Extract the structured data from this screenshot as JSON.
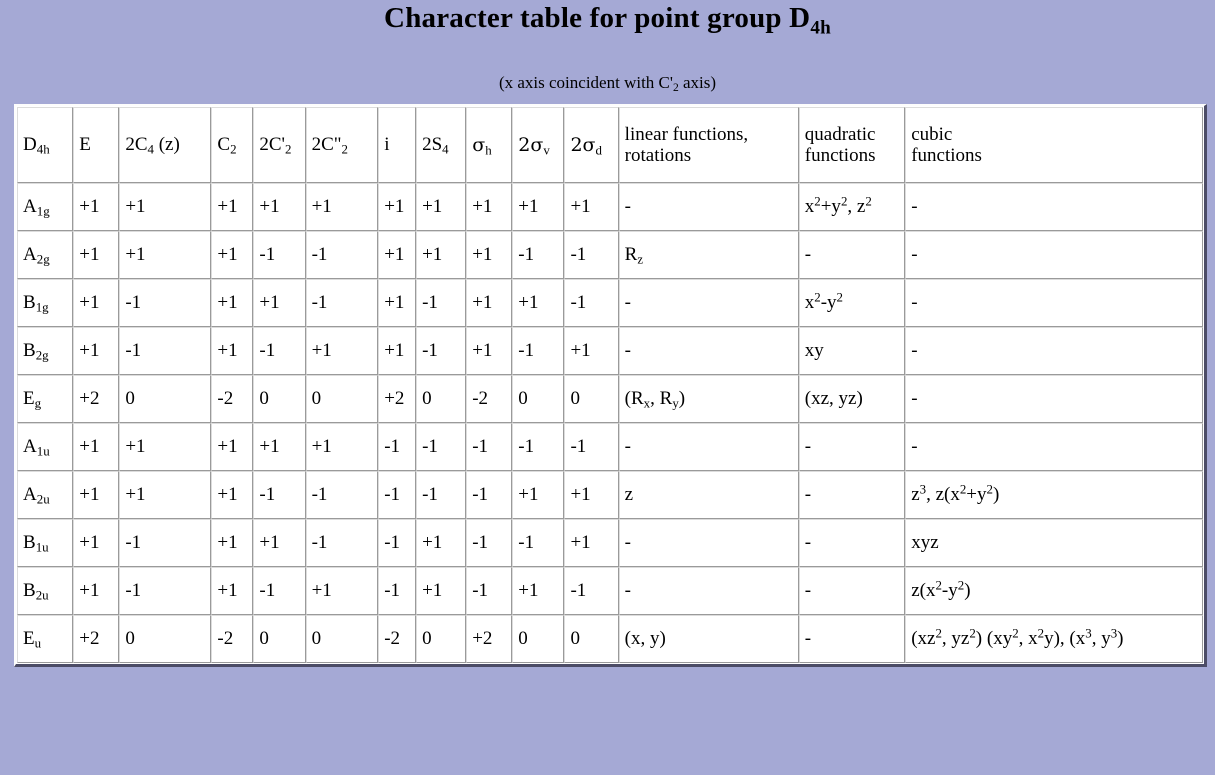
{
  "title": {
    "text_main": "Character table for point group D",
    "text_sub": "4h",
    "subtitle_before": "(x axis coincident with C'",
    "subtitle_sub": "2",
    "subtitle_after": " axis)"
  },
  "colors": {
    "page_background": "#a5a9d5",
    "table_background": "#ffffff",
    "border_dark": "#4c4c66",
    "cell_border_light": "#dcdcdc",
    "cell_border_dark": "#9a9a9a",
    "text": "#000000"
  },
  "table": {
    "headers": [
      {
        "base": "D",
        "sub": "4h",
        "bold": true
      },
      {
        "base": "E"
      },
      {
        "base": "2C",
        "sub": "4",
        "after": " (z)"
      },
      {
        "base": "C",
        "sub": "2"
      },
      {
        "base": "2C'",
        "sub": "2"
      },
      {
        "base": "2C\"",
        "sub": "2"
      },
      {
        "base": "i"
      },
      {
        "base": "2S",
        "sub": "4"
      },
      {
        "base": "σ",
        "sub": "h"
      },
      {
        "base": "2σ",
        "sub": "v"
      },
      {
        "base": "2σ",
        "sub": "d"
      },
      {
        "line1": "linear functions,",
        "line2": "rotations"
      },
      {
        "line1": "quadratic",
        "line2": "functions"
      },
      {
        "line1": "cubic",
        "line2": "functions"
      }
    ],
    "rows": [
      {
        "symbol_base": "A",
        "symbol_sub": "1g",
        "characters": [
          "+1",
          "+1",
          "+1",
          "+1",
          "+1",
          "+1",
          "+1",
          "+1",
          "+1",
          "+1"
        ],
        "linear": "-",
        "quadratic": "x<sup>2</sup>+y<sup>2</sup>, z<sup>2</sup>",
        "cubic": "-"
      },
      {
        "symbol_base": "A",
        "symbol_sub": "2g",
        "characters": [
          "+1",
          "+1",
          "+1",
          "-1",
          "-1",
          "+1",
          "+1",
          "+1",
          "-1",
          "-1"
        ],
        "linear": "R<sub>z</sub>",
        "quadratic": "-",
        "cubic": "-"
      },
      {
        "symbol_base": "B",
        "symbol_sub": "1g",
        "characters": [
          "+1",
          "-1",
          "+1",
          "+1",
          "-1",
          "+1",
          "-1",
          "+1",
          "+1",
          "-1"
        ],
        "linear": "-",
        "quadratic": "x<sup>2</sup>-y<sup>2</sup>",
        "cubic": "-"
      },
      {
        "symbol_base": "B",
        "symbol_sub": "2g",
        "characters": [
          "+1",
          "-1",
          "+1",
          "-1",
          "+1",
          "+1",
          "-1",
          "+1",
          "-1",
          "+1"
        ],
        "linear": "-",
        "quadratic": "xy",
        "cubic": "-"
      },
      {
        "symbol_base": "E",
        "symbol_sub": "g",
        "characters": [
          "+2",
          "0",
          "-2",
          "0",
          "0",
          "+2",
          "0",
          "-2",
          "0",
          "0"
        ],
        "linear": "(R<sub>x</sub>, R<sub>y</sub>)",
        "quadratic": "(xz, yz)",
        "cubic": "-"
      },
      {
        "symbol_base": "A",
        "symbol_sub": "1u",
        "characters": [
          "+1",
          "+1",
          "+1",
          "+1",
          "+1",
          "-1",
          "-1",
          "-1",
          "-1",
          "-1"
        ],
        "linear": "-",
        "quadratic": "-",
        "cubic": "-"
      },
      {
        "symbol_base": "A",
        "symbol_sub": "2u",
        "characters": [
          "+1",
          "+1",
          "+1",
          "-1",
          "-1",
          "-1",
          "-1",
          "-1",
          "+1",
          "+1"
        ],
        "linear": "z",
        "quadratic": "-",
        "cubic": "z<sup>3</sup>, z(x<sup>2</sup>+y<sup>2</sup>)"
      },
      {
        "symbol_base": "B",
        "symbol_sub": "1u",
        "characters": [
          "+1",
          "-1",
          "+1",
          "+1",
          "-1",
          "-1",
          "+1",
          "-1",
          "-1",
          "+1"
        ],
        "linear": "-",
        "quadratic": "-",
        "cubic": "xyz"
      },
      {
        "symbol_base": "B",
        "symbol_sub": "2u",
        "characters": [
          "+1",
          "-1",
          "+1",
          "-1",
          "+1",
          "-1",
          "+1",
          "-1",
          "+1",
          "-1"
        ],
        "linear": "-",
        "quadratic": "-",
        "cubic": "z(x<sup>2</sup>-y<sup>2</sup>)"
      },
      {
        "symbol_base": "E",
        "symbol_sub": "u",
        "characters": [
          "+2",
          "0",
          "-2",
          "0",
          "0",
          "-2",
          "0",
          "+2",
          "0",
          "0"
        ],
        "linear": "(x, y)",
        "quadratic": "-",
        "cubic": "(xz<sup>2</sup>, yz<sup>2</sup>) (xy<sup>2</sup>, x<sup>2</sup>y), (x<sup>3</sup>, y<sup>3</sup>)"
      }
    ]
  }
}
